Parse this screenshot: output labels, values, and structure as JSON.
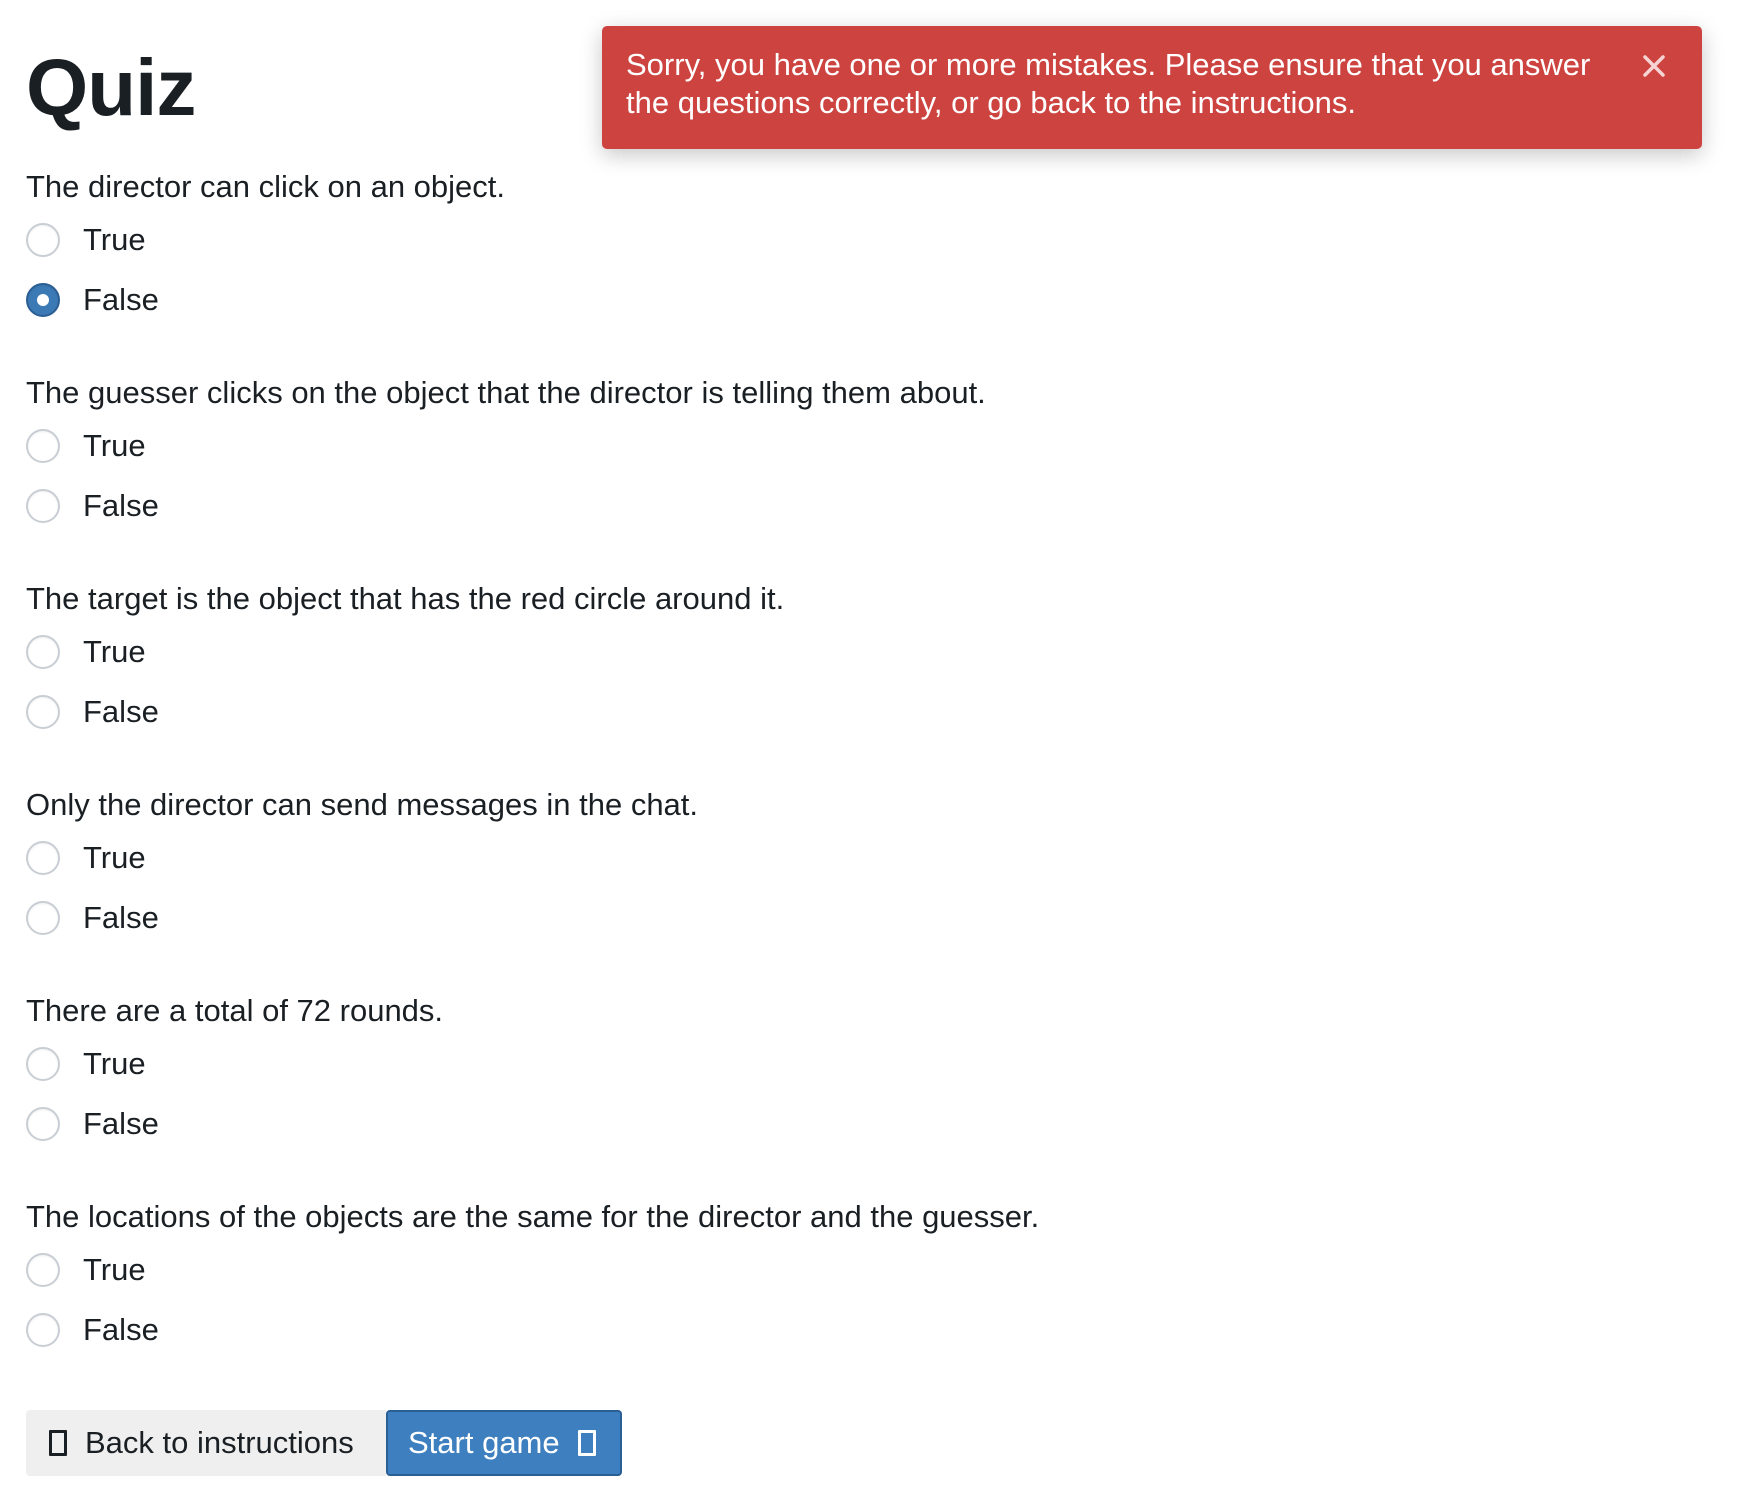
{
  "page": {
    "title": "Quiz"
  },
  "alert": {
    "message": "Sorry, you have one or more mistakes. Please ensure that you answer the questions correctly, or go back to the instructions.",
    "close_icon": "close-icon",
    "color": "#cc4340"
  },
  "questions": [
    {
      "text": "The director can click on an object.",
      "options": [
        {
          "label": "True",
          "checked": false
        },
        {
          "label": "False",
          "checked": true
        }
      ]
    },
    {
      "text": "The guesser clicks on the object that the director is telling them about.",
      "options": [
        {
          "label": "True",
          "checked": false
        },
        {
          "label": "False",
          "checked": false
        }
      ]
    },
    {
      "text": "The target is the object that has the red circle around it.",
      "options": [
        {
          "label": "True",
          "checked": false
        },
        {
          "label": "False",
          "checked": false
        }
      ]
    },
    {
      "text": "Only the director can send messages in the chat.",
      "options": [
        {
          "label": "True",
          "checked": false
        },
        {
          "label": "False",
          "checked": false
        }
      ]
    },
    {
      "text": "There are a total of 72 rounds.",
      "options": [
        {
          "label": "True",
          "checked": false
        },
        {
          "label": "False",
          "checked": false
        }
      ]
    },
    {
      "text": "The locations of the objects are the same for the director and the guesser.",
      "options": [
        {
          "label": "True",
          "checked": false
        },
        {
          "label": "False",
          "checked": false
        }
      ]
    }
  ],
  "buttons": {
    "back_label": "Back to instructions",
    "back_icon": "missing-glyph-icon",
    "start_label": "Start game",
    "start_icon": "missing-glyph-icon",
    "start_color": "#3e7fbf"
  }
}
